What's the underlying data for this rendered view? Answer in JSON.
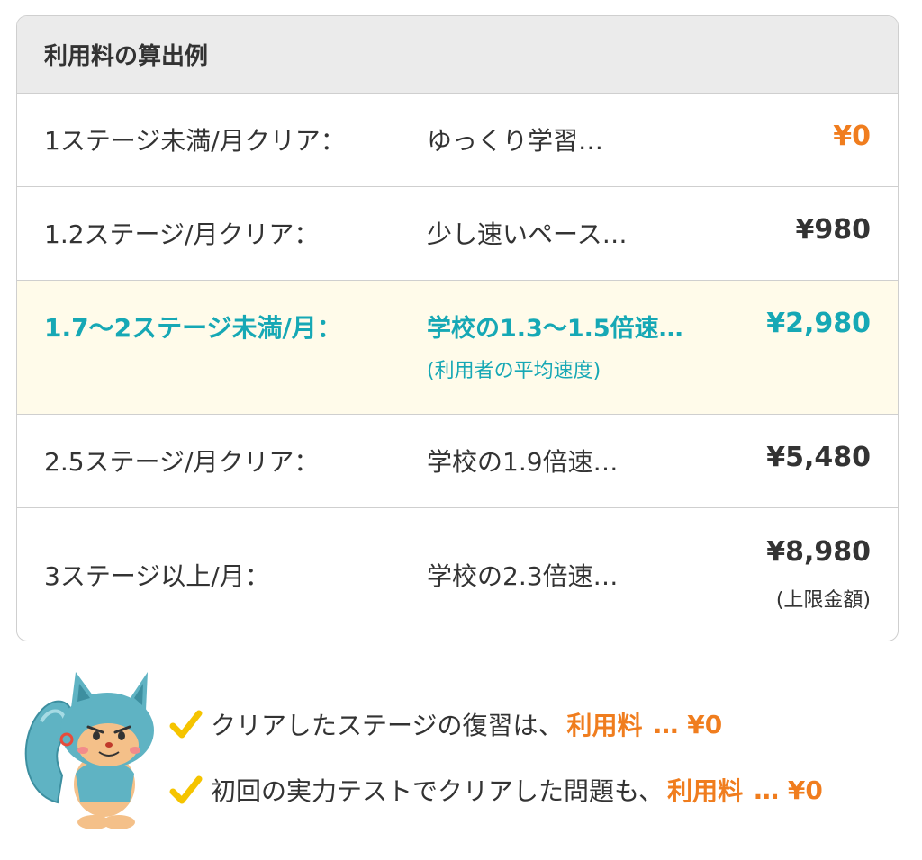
{
  "table": {
    "title": "利用料の算出例",
    "rows": [
      {
        "label": "1ステージ未満/月クリア：",
        "desc": "ゆっくり学習…",
        "price": "¥0"
      },
      {
        "label": "1.2ステージ/月クリア：",
        "desc": "少し速いペース…",
        "price": "¥980"
      },
      {
        "label": "1.7〜2ステージ未満/月：",
        "desc": "学校の1.3〜1.5倍速…",
        "desc_sub": "(利用者の平均速度)",
        "price": "¥2,980"
      },
      {
        "label": "2.5ステージ/月クリア：",
        "desc": "学校の1.9倍速…",
        "price": "¥5,480"
      },
      {
        "label": "3ステージ以上/月：",
        "desc": "学校の2.3倍速…",
        "price": "¥8,980",
        "price_sub": "(上限金額)"
      }
    ]
  },
  "notes": [
    {
      "text": "クリアしたステージの復習は、",
      "emph": "利用料",
      "price": "… ¥0"
    },
    {
      "text": "初回の実力テストでクリアした問題も、",
      "emph": "利用料",
      "price": "… ¥0"
    }
  ],
  "colors": {
    "accent_orange": "#f07d1e",
    "accent_teal": "#16a8b5",
    "highlight_bg": "#fffbea",
    "header_bg": "#ebebeb",
    "check_yellow": "#f5c400"
  },
  "icons": {
    "check": "check-icon",
    "mascot": "squirrel-mascot"
  }
}
